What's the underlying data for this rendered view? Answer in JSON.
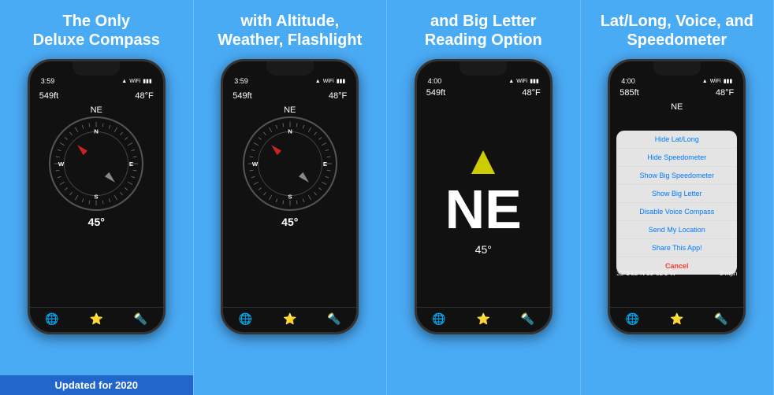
{
  "panels": [
    {
      "id": "panel1",
      "header": "The Only\nDeluxe Compass",
      "footer": "Updated for 2020",
      "has_footer": true
    },
    {
      "id": "panel2",
      "header": "with Altitude,\nWeather, Flashlight",
      "footer": "",
      "has_footer": false
    },
    {
      "id": "panel3",
      "header": "and Big Letter\nReading Option",
      "footer": "",
      "has_footer": false
    },
    {
      "id": "panel4",
      "header": "Lat/Long, Voice, and\nSpeedometer",
      "footer": "",
      "has_footer": false
    }
  ],
  "phone_screens": {
    "common": {
      "status_time": "3:59",
      "altitude": "549ft",
      "temp": "48°F",
      "direction": "NE",
      "degrees": "45°"
    },
    "screen4": {
      "status_time": "4:00",
      "altitude": "585ft",
      "temp": "48°F",
      "direction": "NE",
      "gps": "32°1'52\"N 93°52'1\"W",
      "speed": "0 mph"
    }
  },
  "menu_items": [
    "Hide Lat/Long",
    "Hide Speedometer",
    "Show Big Speedometer",
    "Show Big Letter",
    "Disable Voice Compass",
    "Send My Location",
    "Share This App!",
    "Cancel"
  ],
  "toolbar_icons": {
    "globe": "🌐",
    "star": "⭐",
    "flashlight": "🔦"
  }
}
